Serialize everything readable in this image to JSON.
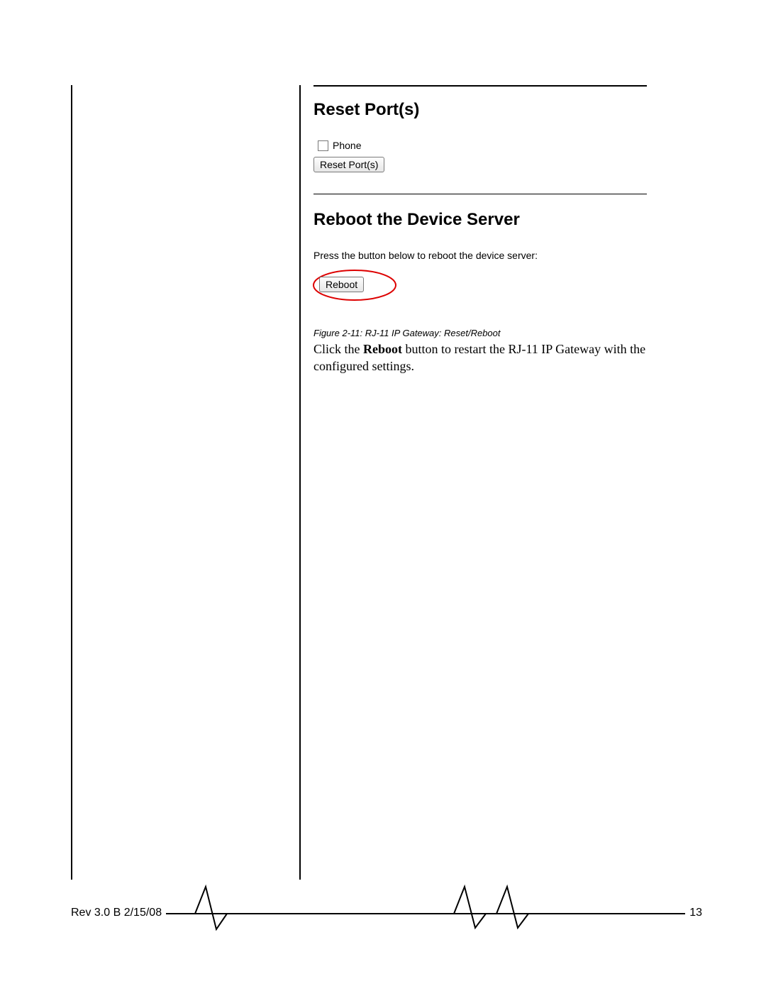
{
  "figure": {
    "reset_heading": "Reset Port(s)",
    "phone_label": "Phone",
    "reset_button": "Reset Port(s)",
    "reboot_heading": "Reboot the Device Server",
    "reboot_instruction": "Press the button below to reboot the device server:",
    "reboot_button": "Reboot",
    "caption": "Figure 2-11:  RJ-11 IP Gateway: Reset/Reboot"
  },
  "body": {
    "pre": "Click the ",
    "bold": "Reboot",
    "post": " button to restart the RJ-11 IP Gateway with the configured settings."
  },
  "footer": {
    "rev": "Rev 3.0 B  2/15/08",
    "page": "13"
  }
}
